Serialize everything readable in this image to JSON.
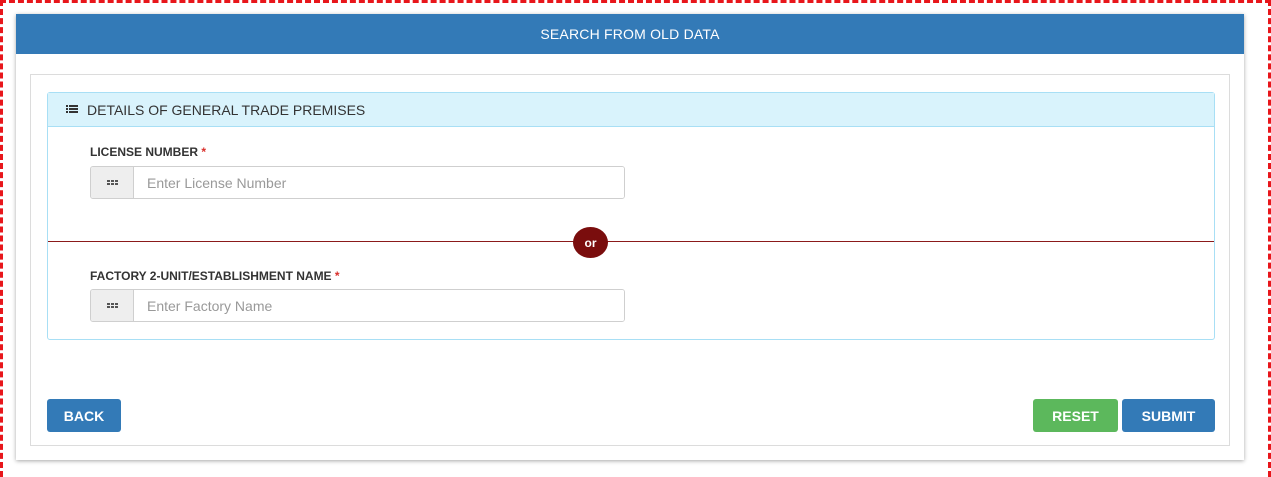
{
  "header": {
    "title": "SEARCH FROM OLD DATA"
  },
  "panel": {
    "heading": "DETAILS OF GENERAL TRADE PREMISES",
    "heading_icon": "list-icon"
  },
  "fields": {
    "license": {
      "label": "LICENSE NUMBER",
      "required_mark": "*",
      "placeholder": "Enter License Number",
      "value": ""
    },
    "separator": "or",
    "factory": {
      "label": "FACTORY 2-UNIT/ESTABLISHMENT NAME",
      "required_mark": "*",
      "placeholder": "Enter Factory Name",
      "value": ""
    }
  },
  "actions": {
    "back_label": "BACK",
    "reset_label": "RESET",
    "submit_label": "SUBMIT"
  },
  "colors": {
    "header_bg": "#337ab7",
    "panel_heading_bg": "#d9f3fc",
    "panel_border": "#a8dff5",
    "divider": "#8b1a1a",
    "or_badge": "#7a0d0d",
    "required": "#d9302c",
    "reset_bg": "#5cb85c",
    "frame_dash": "#e8161b"
  }
}
